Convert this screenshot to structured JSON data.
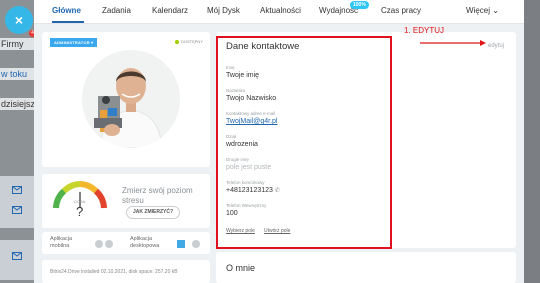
{
  "background": {
    "close_icon": "×",
    "items": [
      "Firmy",
      "w toku",
      "dzisiejszy"
    ],
    "badge": "4"
  },
  "tabs": {
    "items": [
      "Główne",
      "Zadania",
      "Kalendarz",
      "Mój Dysk",
      "Aktualności",
      "Wydajność",
      "Czas pracy"
    ],
    "more": "Więcej ⌄",
    "badge_wydajnosc": "100%"
  },
  "profile": {
    "role_badge": "ADMINISTRATOR",
    "status": "DOSTĘPNY"
  },
  "stress": {
    "title": "Zmierz swój poziom stresu",
    "button": "JAK ZMIERZYĆ?",
    "value": "?",
    "scale_label": "DOBA"
  },
  "apps": {
    "mobile": "Aplikacja mobilna",
    "desktop": "Aplikacja desktopowa"
  },
  "disk": {
    "text": "Bitrix24.Drive installed 02.10.2021, disk space: 257.20 kB"
  },
  "contact": {
    "title": "Dane kontaktowe",
    "edit": "edytuj",
    "fields": [
      {
        "label": "Imię",
        "value": "Twoje imię"
      },
      {
        "label": "Nazwisko",
        "value": "Twojo Nazwisko"
      },
      {
        "label": "Kontaktowy adres e-mail",
        "value": "TwojMail@g4r.pl"
      },
      {
        "label": "Dział",
        "value": "wdrozenia"
      },
      {
        "label": "Drugie imię",
        "value": "pole jest puste"
      },
      {
        "label": "Telefon komórkowy",
        "value": "+48123123123"
      },
      {
        "label": "Telefon Wewnętrzny",
        "value": "100"
      }
    ],
    "select_fields": "Wybierz pole",
    "create_field": "Utwórz pole"
  },
  "about": {
    "title": "O mnie"
  },
  "annotation": {
    "text": "1. EDYTUJ",
    "color": "#e01616"
  },
  "colors": {
    "accent": "#2067b0",
    "badge_blue": "#39a8ef",
    "status_green": "#9dcf00",
    "highlight_red": "#e0101d"
  }
}
